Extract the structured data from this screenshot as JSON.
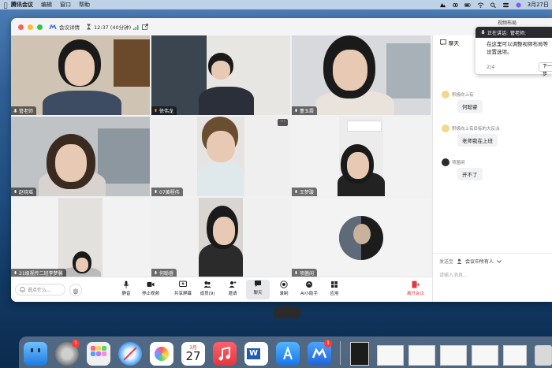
{
  "menubar": {
    "app_name": "腾讯会议",
    "menus": [
      "编辑",
      "窗口",
      "帮助"
    ],
    "date": "3月27日"
  },
  "titlebar": {
    "meeting_info": "会议详情",
    "timer": "12:37 (40分钟)"
  },
  "participants": [
    {
      "name": "管老师",
      "speaking": true
    },
    {
      "name": "徐伟龙"
    },
    {
      "name": "董玉霞"
    },
    {
      "name": "赵晓瑶"
    },
    {
      "name": "07黄程伟"
    },
    {
      "name": "王梦璇"
    },
    {
      "name": "21级视传二班李梦馨"
    },
    {
      "name": "何聪睿"
    },
    {
      "name": "项菌闲"
    }
  ],
  "chat": {
    "title": "聊天",
    "messages": [
      {
        "sender": "积极向上有",
        "text": "何聪睿"
      },
      {
        "sender": "积极向上有目标的大反派",
        "text": "老师我在上班"
      },
      {
        "sender": "项菌闲",
        "text": "开不了"
      }
    ],
    "send_to_label": "发送至",
    "send_to_value": "会议中所有人",
    "input_placeholder": "请输入消息..."
  },
  "popup": {
    "speaking_label": "正在讲话:",
    "speaker": "管老师;",
    "text": "在这里可以调整视频布局等设置选项。",
    "page": "2/4",
    "next": "下一步",
    "layout_badge": "视频布局"
  },
  "toolbar": {
    "say_placeholder": "说点什么...",
    "tools": [
      "静音",
      "停止视频",
      "共享屏幕",
      "成员(9)",
      "邀请",
      "聊天",
      "录制",
      "AI小助手",
      "应用"
    ],
    "leave": "离开会议"
  },
  "dock": {
    "calendar_month": "3月",
    "calendar_day": "27",
    "settings_badge": "1",
    "meeting_badge": "1"
  },
  "colors": {
    "active_border": "#4fd36b",
    "leave_red": "#e5383b",
    "accent_blue": "#2f6bd8"
  }
}
